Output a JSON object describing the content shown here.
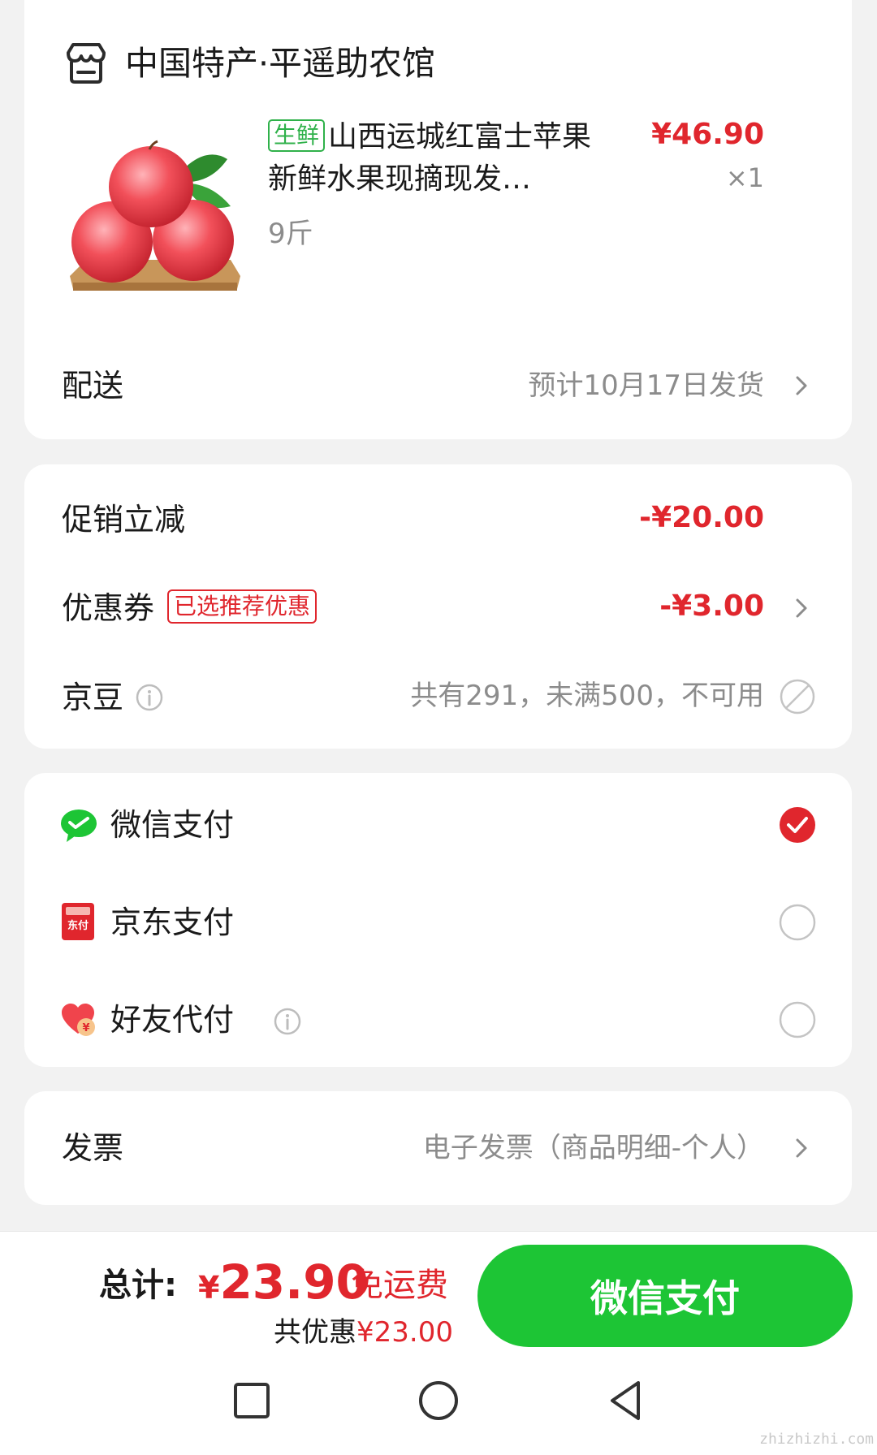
{
  "store": {
    "name": "中国特产·平遥助农馆"
  },
  "product": {
    "tag": "生鲜",
    "title": "山西运城红富士苹果 新鲜水果现摘现发…",
    "spec": "9斤",
    "price": "¥46.90",
    "quantity": "×1"
  },
  "delivery": {
    "label": "配送",
    "value": "预计10月17日发货"
  },
  "promotion": {
    "label": "促销立减",
    "value": "-¥20.00"
  },
  "coupon": {
    "label": "优惠券",
    "badge": "已选推荐优惠",
    "value": "-¥3.00"
  },
  "jingdou": {
    "label": "京豆",
    "value": "共有291，未满500，不可用"
  },
  "payment": {
    "methods": [
      {
        "label": "微信支付",
        "icon": "wechat-pay-icon",
        "selected": true
      },
      {
        "label": "京东支付",
        "icon": "jd-pay-icon",
        "icon_text": "东付",
        "selected": false
      },
      {
        "label": "好友代付",
        "icon": "friend-pay-heart-icon",
        "selected": false
      }
    ]
  },
  "invoice": {
    "label": "发票",
    "value": "电子发票（商品明细-个人）"
  },
  "footer": {
    "total_label": "总计:",
    "currency": "¥",
    "total": "23.90",
    "shipping": "免运费",
    "saved_label": "共优惠",
    "saved_amount": "¥23.00",
    "pay_button": "微信支付"
  },
  "watermark": "zhizhizhi.com",
  "colors": {
    "accent_red": "#e0262d",
    "pay_green": "#1dc535",
    "fresh_green": "#2fb14a"
  }
}
